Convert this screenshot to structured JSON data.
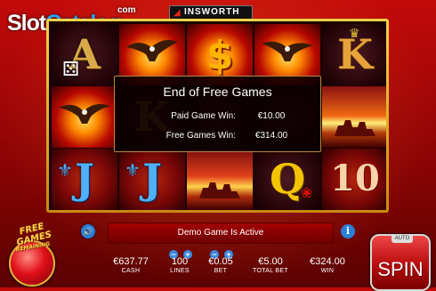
{
  "watermark": {
    "part1": "Slot",
    "part2": "Catalog",
    "suffix": "com"
  },
  "brand": {
    "logo_glyph": "◢",
    "name": "INSWORTH"
  },
  "reels": [
    [
      "letter-a",
      "eagle",
      "letter-j"
    ],
    [
      "eagle",
      "letter-k-dark",
      "letter-j"
    ],
    [
      "dollar",
      "dark",
      "butte"
    ],
    [
      "eagle",
      "dark",
      "letter-q"
    ],
    [
      "letter-k",
      "butte",
      "letter-10"
    ]
  ],
  "symbols": {
    "a": "A",
    "k": "K",
    "j": "J",
    "q": "Q",
    "ten": "10",
    "dollar": "$",
    "dice": "⚄",
    "heart": "♛",
    "fleur": "⚜",
    "rose": "❀"
  },
  "dialog": {
    "title": "End of Free Games",
    "paid_label": "Paid Game Win:",
    "paid_value": "€10.00",
    "free_label": "Free Games Win:",
    "free_value": "€314.00"
  },
  "free_games_badge": {
    "line1": "FREE GAMES",
    "line2": "REMAINING"
  },
  "message": "Demo Game Is Active",
  "icons": {
    "sound": "🔊",
    "info": "i",
    "minus": "−",
    "plus": "+"
  },
  "stats": {
    "cash": {
      "value": "€637.77",
      "label": "CASH"
    },
    "lines": {
      "value": "100",
      "label": "LINES"
    },
    "bet": {
      "value": "€0.05",
      "label": "BET"
    },
    "total_bet": {
      "value": "€5.00",
      "label": "TOTAL BET"
    },
    "win": {
      "value": "€324.00",
      "label": "WIN"
    }
  },
  "spin": {
    "auto_label": "AUTO",
    "spin_label": "SPIN"
  },
  "colors": {
    "frame": "#f7d24a",
    "background": "#c40a0a",
    "button_blue": "#2a7fd8"
  }
}
